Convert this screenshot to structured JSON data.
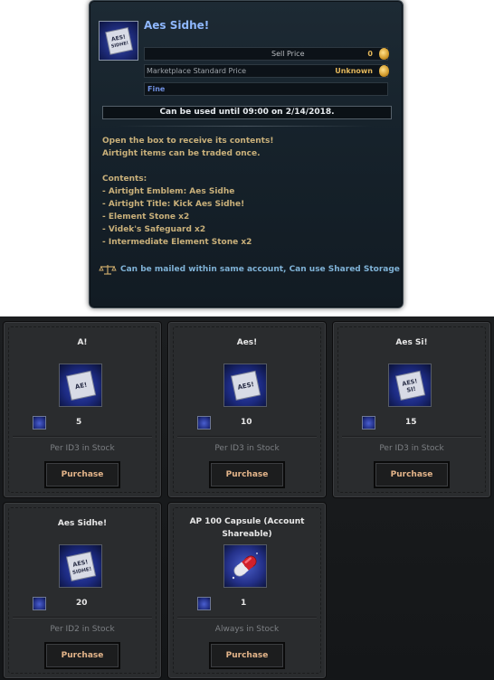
{
  "tooltip": {
    "item_name": "Aes Sidhe!",
    "sell_price_label": "Sell Price",
    "sell_price_value": "0",
    "market_price_label": "Marketplace Standard Price",
    "market_price_value": "Unknown",
    "grade": "Fine",
    "usage_limit": "Can be used until 09:00 on 2/14/2018.",
    "description": [
      "Open the box to receive its contents!",
      "Airtight items can be traded once."
    ],
    "contents_header": "Contents:",
    "contents": [
      "- Airtight Emblem: Aes Sidhe",
      "- Airtight Title: Kick Aes Sidhe!",
      "- Element Stone x2",
      "- Videk's Safeguard x2",
      "- Intermediate Element Stone x2"
    ],
    "mail_note": "Can be mailed within same account, Can use Shared Storage",
    "icon_text": "AES! SIDHE!",
    "colors": {
      "name": "#8fb8ff",
      "grade": "#6f8fe0",
      "price_value": "#e2b65a",
      "description": "#c9b07a",
      "mail_note": "#7fb2d6"
    }
  },
  "shop": {
    "items": [
      {
        "title": "A!",
        "icon_text": "AE!",
        "cost": "5",
        "stock": "Per ID3 in Stock",
        "button": "Purchase"
      },
      {
        "title": "Aes!",
        "icon_text": "AES!",
        "cost": "10",
        "stock": "Per ID3 in Stock",
        "button": "Purchase"
      },
      {
        "title": "Aes Si!",
        "icon_text": "AES! SI!",
        "cost": "15",
        "stock": "Per ID3 in Stock",
        "button": "Purchase"
      },
      {
        "title": "Aes Sidhe!",
        "icon_text": "AES! SIDHE!",
        "cost": "20",
        "stock": "Per ID2 in Stock",
        "button": "Purchase"
      },
      {
        "title": "AP 100 Capsule (Account Shareable)",
        "icon_text": "",
        "cost": "1",
        "stock": "Always in Stock",
        "button": "Purchase"
      }
    ],
    "colors": {
      "button_text": "#e4b58a",
      "stock_text": "#7c7f83"
    }
  }
}
